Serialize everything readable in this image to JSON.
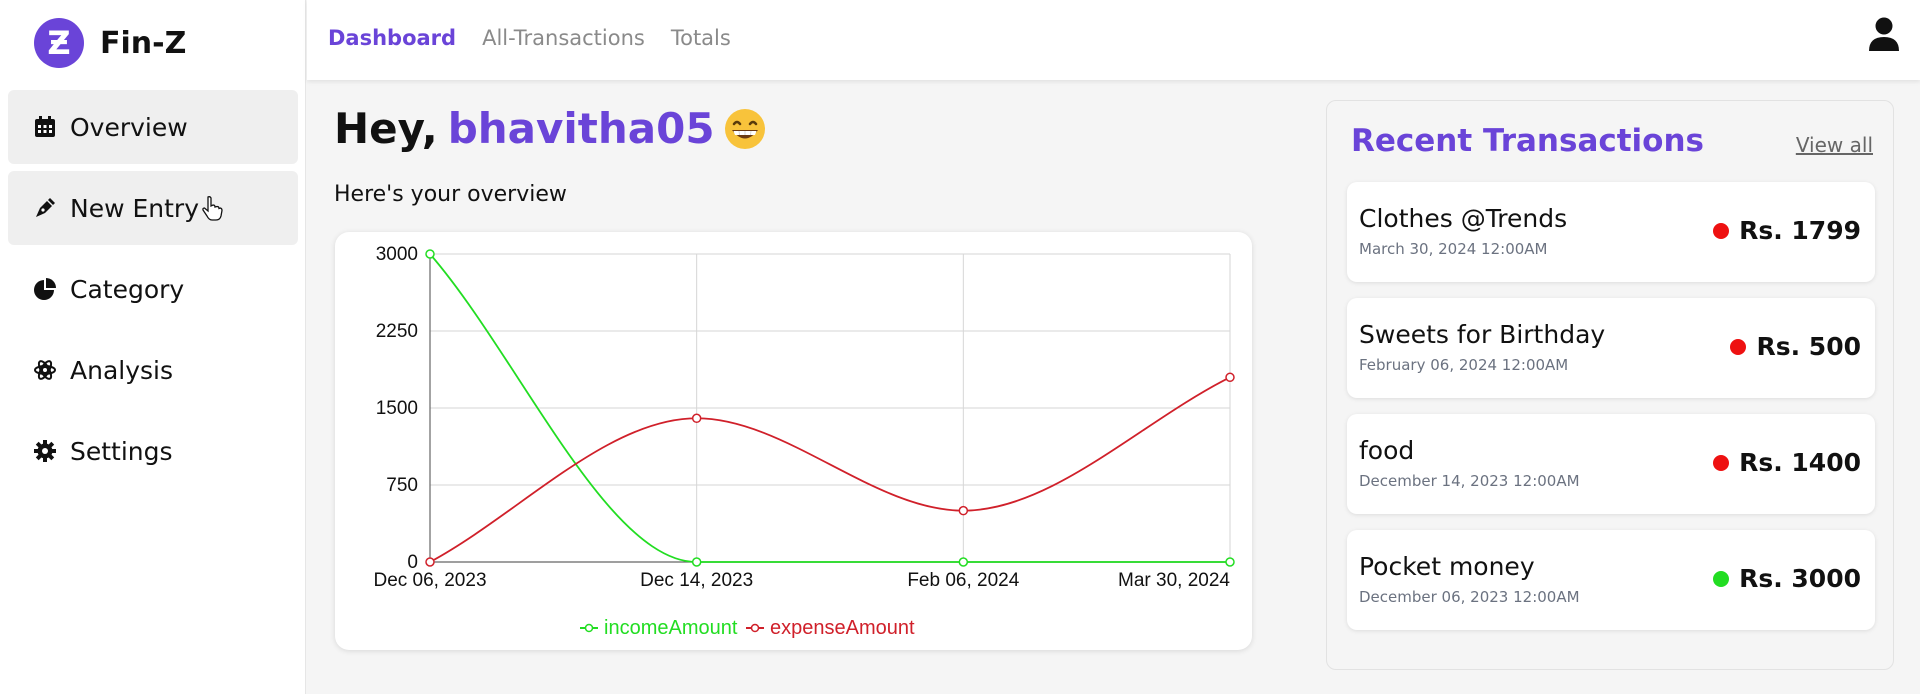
{
  "brand": {
    "logo_glyph": "Ƶ",
    "name": "Fin-Z",
    "accent": "#6a44d8"
  },
  "sidebar": {
    "items": [
      {
        "label": "Overview",
        "icon": "calendar-icon"
      },
      {
        "label": "New Entry",
        "icon": "pen-icon"
      },
      {
        "label": "Category",
        "icon": "pie-chart-icon"
      },
      {
        "label": "Analysis",
        "icon": "brain-icon"
      },
      {
        "label": "Settings",
        "icon": "gear-icon"
      }
    ]
  },
  "topbar": {
    "tabs": [
      "Dashboard",
      "All-Transactions",
      "Totals"
    ],
    "active_tab": "Dashboard",
    "user_icon": "user-icon"
  },
  "main": {
    "greeting_prefix": "Hey,",
    "username": "bhavitha05",
    "emoji": "grinning-face-icon",
    "subtitle": "Here's your overview"
  },
  "chart_data": {
    "type": "line",
    "x": [
      "Dec 06, 2023",
      "Dec 14, 2023",
      "Feb 06, 2024",
      "Mar 30, 2024"
    ],
    "series": [
      {
        "name": "incomeAmount",
        "color": "#22dd22",
        "values": [
          3000,
          0,
          0,
          0
        ]
      },
      {
        "name": "expenseAmount",
        "color": "#d0202a",
        "values": [
          0,
          1400,
          500,
          1799
        ]
      }
    ],
    "y_ticks": [
      "0",
      "750",
      "1500",
      "2250",
      "3000"
    ],
    "ylim": [
      0,
      3000
    ],
    "grid": true,
    "legend": "bottom"
  },
  "recent": {
    "title": "Recent Transactions",
    "view_all": "View all",
    "transactions": [
      {
        "name": "Clothes @Trends",
        "date": "March 30, 2024 12:00AM",
        "amount": "Rs. 1799",
        "status_color": "#ee1111"
      },
      {
        "name": "Sweets for Birthday",
        "date": "February 06, 2024 12:00AM",
        "amount": "Rs. 500",
        "status_color": "#ee1111"
      },
      {
        "name": "food",
        "date": "December 14, 2023 12:00AM",
        "amount": "Rs. 1400",
        "status_color": "#ee1111"
      },
      {
        "name": "Pocket money",
        "date": "December 06, 2023 12:00AM",
        "amount": "Rs. 3000",
        "status_color": "#22dd22"
      }
    ]
  }
}
